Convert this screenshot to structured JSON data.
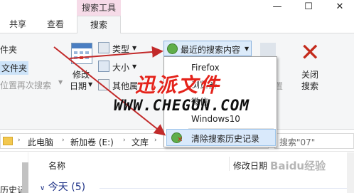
{
  "title_bar": {
    "context_tab": "搜索工具",
    "minimize": "—",
    "maximize": "☐",
    "close": "✕"
  },
  "tabs": [
    {
      "label": "共享"
    },
    {
      "label": "查看"
    },
    {
      "label": "搜索",
      "active": true
    }
  ],
  "ribbon": {
    "left_items": [
      "件夹",
      "文件夹",
      "位置再次搜索"
    ],
    "modified_date": {
      "line1": "修改",
      "line2": "日期"
    },
    "kind": "类型",
    "size": "大小",
    "other_props": "其他属",
    "recent_searches": "最近的搜索内容",
    "close_search": {
      "line1": "关闭",
      "line2": "搜索"
    },
    "hidden_right": "置"
  },
  "dropdown": {
    "items": [
      "Firefox",
      "浏览器",
      "微信",
      "Windows10"
    ],
    "clear_history": "清除搜索历史记录"
  },
  "address_bar": {
    "crumbs": [
      "此电脑",
      "新加卷 (E:)",
      "文库"
    ],
    "search_text": "搜索\"07\""
  },
  "file_list": {
    "col_name": "名称",
    "col_modified": "修改日期",
    "group_today": "今天 (5)",
    "nav_cut_text": "历史记"
  },
  "watermarks": {
    "brand_cn": "迅派文件",
    "brand_url": "WWW.CHEGUN.COM",
    "baidu": "Baidu经验"
  },
  "colors": {
    "accent_blue": "#2a78d6",
    "context_pink": "#f6dbe8",
    "arrow_red": "#c22a2a",
    "close_red": "#c42b1c"
  },
  "icons": {
    "recent": "search-history-icon",
    "close": "close-search-icon",
    "clear": "clear-history-icon"
  }
}
